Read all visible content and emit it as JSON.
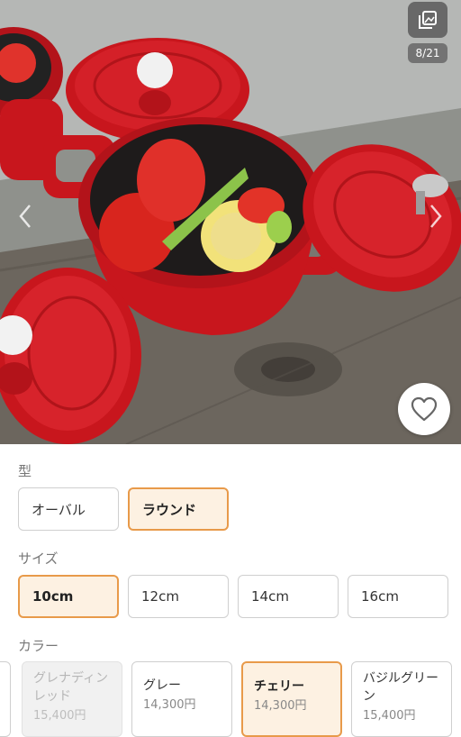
{
  "gallery": {
    "counter": "8/21",
    "icons": {
      "gallery": "image-stack-icon",
      "prev": "chevron-left-icon",
      "next": "chevron-right-icon",
      "favorite": "heart-outline-icon"
    }
  },
  "options": {
    "shape": {
      "label": "型",
      "items": [
        {
          "label": "オーバル",
          "selected": false
        },
        {
          "label": "ラウンド",
          "selected": true
        }
      ]
    },
    "size": {
      "label": "サイズ",
      "items": [
        {
          "label": "10cm",
          "selected": true
        },
        {
          "label": "12cm",
          "selected": false
        },
        {
          "label": "14cm",
          "selected": false
        },
        {
          "label": "16cm",
          "selected": false
        }
      ]
    },
    "color": {
      "label": "カラー",
      "items": [
        {
          "name": "グレナディンレッド",
          "price": "15,400円",
          "state": "disabled"
        },
        {
          "name": "グレー",
          "price": "14,300円",
          "state": "normal"
        },
        {
          "name": "チェリー",
          "price": "14,300円",
          "state": "selected"
        },
        {
          "name": "バジルグリーン",
          "price": "15,400円",
          "state": "normal"
        }
      ]
    }
  },
  "colors": {
    "accent": "#e89a4a",
    "selected_bg": "#fdf1e2",
    "cocotte_red": "#c8161d"
  }
}
